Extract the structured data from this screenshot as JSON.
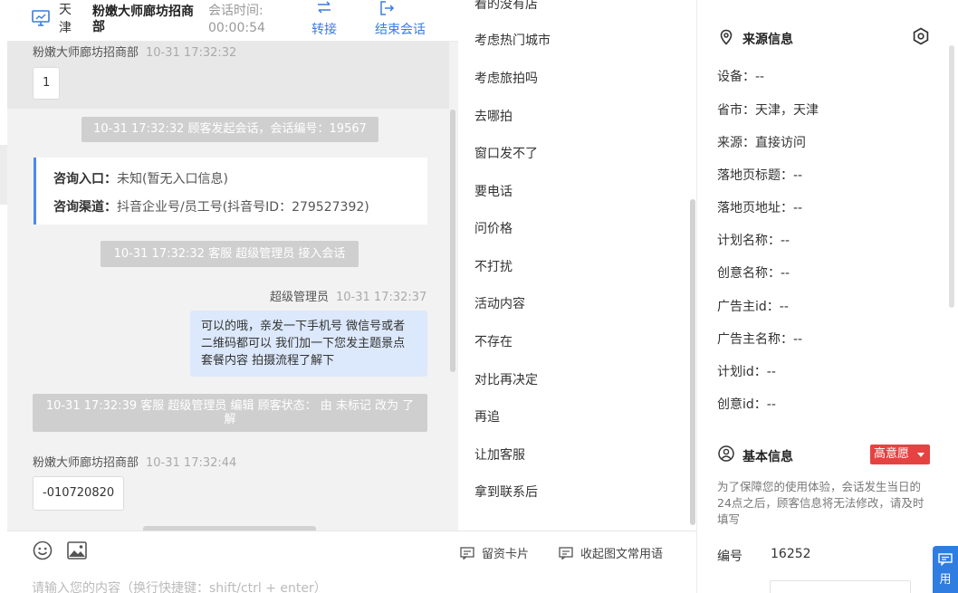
{
  "header": {
    "city": "天津",
    "shop_name": "粉嫩大师廊坊招商部",
    "timer_label": "会话时间:",
    "timer_value": "00:00:54",
    "transfer_label": "转接",
    "end_label": "结束会话"
  },
  "chat": {
    "messages": [
      {
        "sender": "粉嫩大师廊坊招商部",
        "time": "10-31 17:32:32",
        "text": "1"
      },
      {
        "system": "10-31 17:32:32 顾客发起会话，会话编号：19567"
      },
      {
        "entry_label": "咨询入口：",
        "entry_value": "未知(暂无入口信息)",
        "channel_label": "咨询渠道：",
        "channel_value": "抖音企业号/员工号(抖音号ID：279527392)"
      },
      {
        "system": "10-31 17:32:32 客服 超级管理员 接入会话"
      },
      {
        "sender": "超级管理员",
        "time": "10-31 17:32:37",
        "text": "可以的哦，亲发一下手机号 微信号或者二维码都可以 我们加一下您发主题景点 套餐内容 拍摄流程了解下"
      },
      {
        "system": "10-31 17:32:39 客服 超级管理员 编辑 顾客状态： 由 未标记 改为 了解"
      },
      {
        "sender": "粉嫩大师廊坊招商部",
        "time": "10-31 17:32:44",
        "text": "-010720820"
      }
    ],
    "input_placeholder": "请输入您的内容（换行快捷键：shift/ctrl + enter）"
  },
  "phrases": {
    "items": [
      "看的没有店",
      "考虑热门城市",
      "考虑旅拍吗",
      "去哪拍",
      "窗口发不了",
      "要电话",
      "问价格",
      "不打扰",
      "活动内容",
      "不存在",
      "对比再决定",
      "再追",
      "让加客服",
      "拿到联系后"
    ],
    "footer_card": "留资卡片",
    "footer_collapse": "收起图文常用语"
  },
  "info": {
    "source_title": "来源信息",
    "rows": [
      {
        "label": "设备：",
        "value": "--"
      },
      {
        "label": "省市：",
        "value": "天津，天津"
      },
      {
        "label": "来源：",
        "value": "直接访问"
      },
      {
        "label": "落地页标题：",
        "value": "--"
      },
      {
        "label": "落地页地址：",
        "value": "--"
      },
      {
        "label": "计划名称：",
        "value": "--"
      },
      {
        "label": "创意名称：",
        "value": "--"
      },
      {
        "label": "广告主id：",
        "value": "--"
      },
      {
        "label": "广告主名称：",
        "value": "--"
      },
      {
        "label": "计划id：",
        "value": "--"
      },
      {
        "label": "创意id：",
        "value": "--"
      }
    ],
    "basic_title": "基本信息",
    "intent_badge": "高意愿",
    "notice": "为了保障您的使用体验，会话发生当日的24点之后，顾客信息将无法修改，请及时填写",
    "number_label": "编号",
    "number_value": "16252",
    "float_label": "用"
  },
  "colors": {
    "accent": "#3a7be0",
    "badge_red": "#e64242",
    "outgoing_bubble": "#dce8fb",
    "system_pill": "#cfcfcf"
  }
}
